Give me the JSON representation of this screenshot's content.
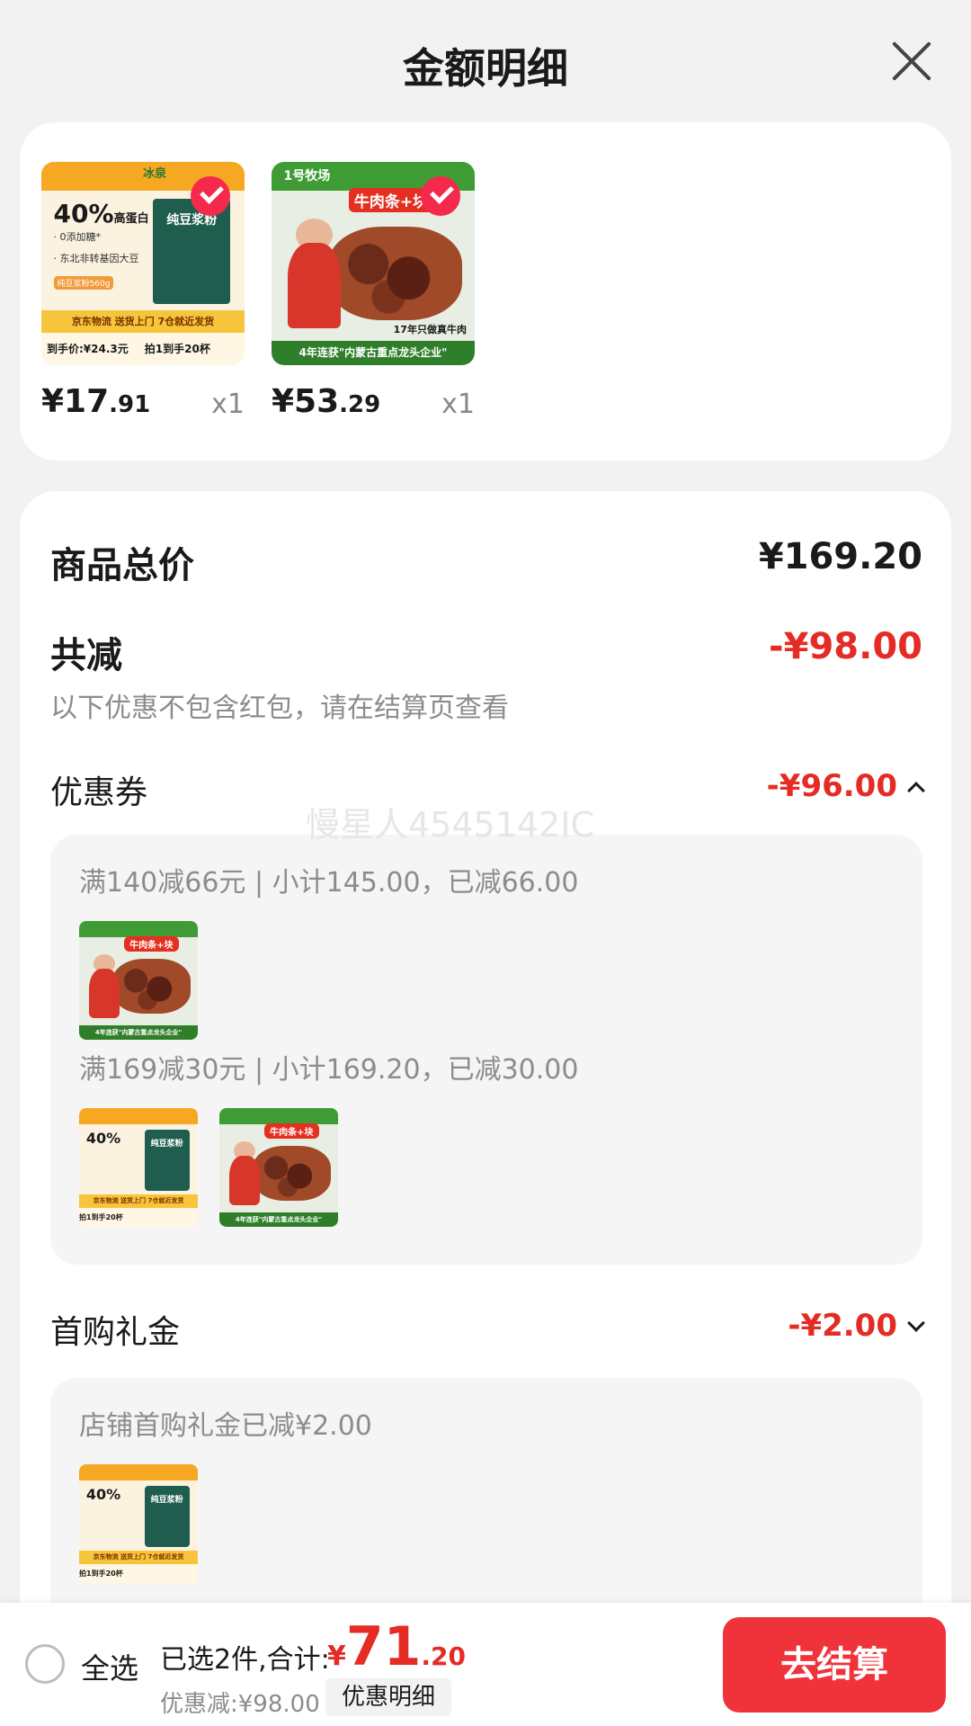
{
  "header": {
    "title": "金额明细"
  },
  "products": [
    {
      "price_int": "¥17",
      "price_dec": ".91",
      "qty": "x1",
      "selected": true,
      "image": "soy"
    },
    {
      "price_int": "¥53",
      "price_dec": ".29",
      "qty": "x1",
      "selected": true,
      "image": "beef"
    }
  ],
  "soy_image": {
    "brand": "冰泉",
    "headline": "40%",
    "headline_suffix": "高蛋白",
    "line1": "· 0添加糖*",
    "line2": "· 东北非转基因大豆",
    "pill": "纯豆浆粉560g",
    "package_label": "纯豆浆粉",
    "band": "京东物流  送货上门  7仓就近发货",
    "foot_price": "到手价:¥24.3元",
    "foot_cups": "拍1到手20杯"
  },
  "beef_image": {
    "brand": "1号牧场",
    "tag": "牛肉条+块",
    "note": "17年只做真牛肉",
    "band": "4年连获\"内蒙古重点龙头企业\""
  },
  "summary": {
    "total_label": "商品总价",
    "total_value": "¥169.20",
    "reduce_label": "共减",
    "reduce_value": "-¥98.00",
    "note": "以下优惠不包含红包，请在结算页查看"
  },
  "coupon": {
    "label": "优惠券",
    "value": "-¥96.00",
    "rule1": "满140减66元 | 小计145.00，已减66.00",
    "rule2": "满169减30元 | 小计169.20，已减30.00"
  },
  "watermark": "慢星人4545142IC",
  "gift": {
    "label": "首购礼金",
    "value": "-¥2.00",
    "note": "店铺首购礼金已减¥2.00"
  },
  "bottom_bar": {
    "select_all": "全选",
    "summary": "已选2件,合计:",
    "total_sym": "¥",
    "total_int": "71",
    "total_dec": ".20",
    "discount": "优惠减:¥98.00",
    "discount_btn": "优惠明细",
    "checkout": "去结算"
  },
  "colors": {
    "accent_red": "#e42c25",
    "checkout_red": "#f0323b",
    "check_red": "#f4294b"
  }
}
